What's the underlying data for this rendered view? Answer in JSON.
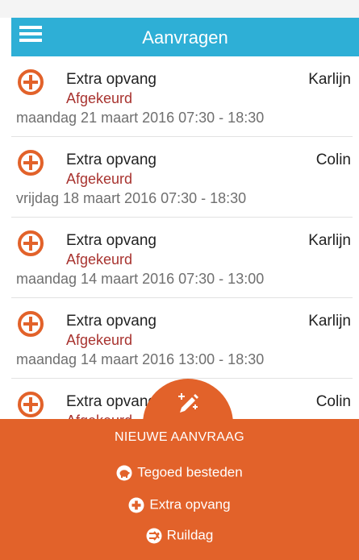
{
  "header": {
    "title": "Aanvragen",
    "menu_icon": "hamburger-icon"
  },
  "requests": [
    {
      "type": "Extra opvang",
      "status": "Afgekeurd",
      "date": "maandag 21 maart 2016 07:30 - 18:30",
      "name": "Karlijn"
    },
    {
      "type": "Extra opvang",
      "status": "Afgekeurd",
      "date": "vrijdag 18 maart 2016 07:30 - 18:30",
      "name": "Colin"
    },
    {
      "type": "Extra opvang",
      "status": "Afgekeurd",
      "date": "maandag 14 maart 2016 07:30 - 13:00",
      "name": "Karlijn"
    },
    {
      "type": "Extra opvang",
      "status": "Afgekeurd",
      "date": "maandag 14 maart 2016 13:00 - 18:30",
      "name": "Karlijn"
    },
    {
      "type": "Extra opvang",
      "status": "Afgekeurd",
      "date": "",
      "name": "Colin"
    }
  ],
  "new_request": {
    "title": "NIEUWE AANVRAAG",
    "options": [
      {
        "label": "Tegoed besteden",
        "icon": "piggy-bank-icon"
      },
      {
        "label": "Extra opvang",
        "icon": "plus-circle-icon"
      },
      {
        "label": "Ruildag",
        "icon": "swap-icon"
      }
    ]
  },
  "colors": {
    "appbar": "#2eafd6",
    "accent": "#e2622a",
    "status_rejected": "#a8332f"
  }
}
